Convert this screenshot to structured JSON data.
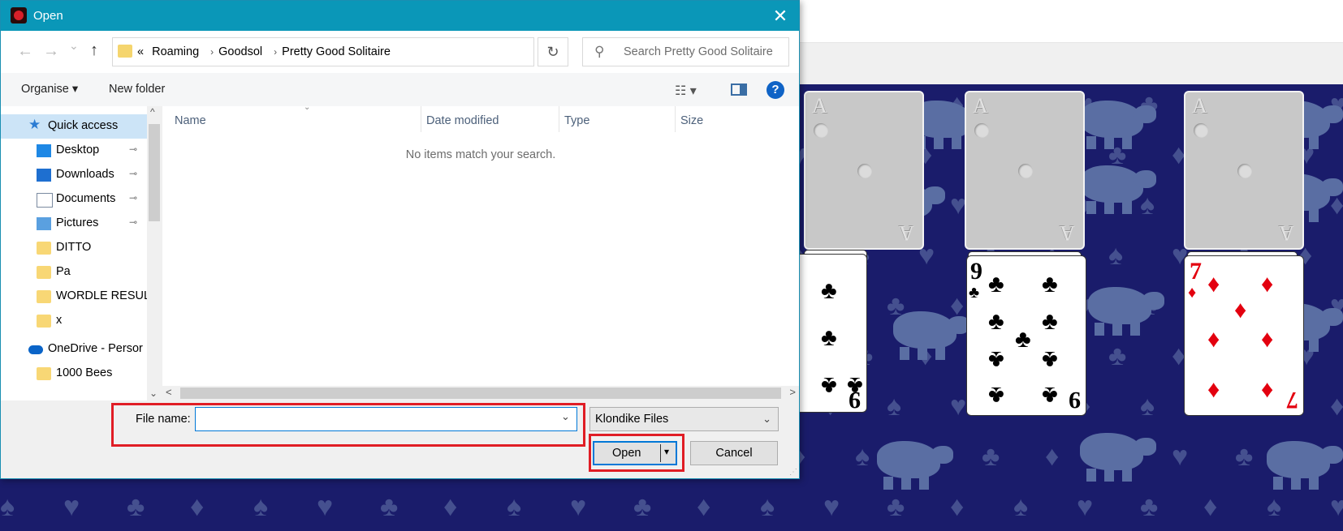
{
  "dialog": {
    "title": "Open",
    "close_glyph": "✕",
    "nav": {
      "back_glyph": "←",
      "forward_glyph": "→",
      "recent_glyph": "⌄",
      "up_glyph": "↑",
      "breadcrumb_prefix": "«",
      "breadcrumbs": [
        "Roaming",
        "Goodsol",
        "Pretty Good Solitaire"
      ],
      "breadcrumb_sep": "›",
      "address_dropdown_glyph": "⌄",
      "refresh_glyph": "↻",
      "search_placeholder": "Search Pretty Good Solitaire",
      "search_glyph": "⚲"
    },
    "toolbar": {
      "organise": "Organise ▾",
      "new_folder": "New folder",
      "view_glyph": "☷ ▾",
      "help": "?"
    },
    "sidebar": {
      "items": [
        {
          "label": "Quick access",
          "icon": "star-icon",
          "pinned": false
        },
        {
          "label": "Desktop",
          "icon": "desktop-icon",
          "pinned": true
        },
        {
          "label": "Downloads",
          "icon": "download-icon",
          "pinned": true
        },
        {
          "label": "Documents",
          "icon": "documents-icon",
          "pinned": true
        },
        {
          "label": "Pictures",
          "icon": "pictures-icon",
          "pinned": true
        },
        {
          "label": "DITTO",
          "icon": "folder-icon",
          "pinned": false
        },
        {
          "label": "Pa",
          "icon": "folder-icon",
          "pinned": false
        },
        {
          "label": "WORDLE RESULT",
          "icon": "folder-icon",
          "pinned": false
        },
        {
          "label": "x",
          "icon": "folder-icon",
          "pinned": false
        },
        {
          "label": "OneDrive - Persor",
          "icon": "cloud-icon",
          "pinned": false
        },
        {
          "label": "1000 Bees",
          "icon": "folder-icon",
          "pinned": false
        }
      ],
      "pin_glyph": "📌",
      "scroll_up_glyph": "^",
      "scroll_down_glyph": "⌄"
    },
    "columns": [
      "Name",
      "Date modified",
      "Type",
      "Size"
    ],
    "empty_message": "No items match your search.",
    "hscroll_left": "<",
    "hscroll_right": ">",
    "file_name_label": "File name:",
    "file_name_value": "",
    "file_name_dropdown": "⌄",
    "file_type": "Klondike Files",
    "file_type_dropdown": "⌄",
    "open_button": "Open",
    "open_split_arrow": "▾",
    "cancel_button": "Cancel",
    "grip_glyph": "⋰"
  },
  "colors": {
    "titlebar": "#0a97b8",
    "felt": "#1a1c6b",
    "highlight": "#e01d25",
    "selection": "#cce4f7"
  },
  "cards": {
    "ace_label": "A",
    "nine_rank": "9",
    "nine_suit": "♣",
    "seven_rank": "7",
    "seven_suit": "♦"
  }
}
